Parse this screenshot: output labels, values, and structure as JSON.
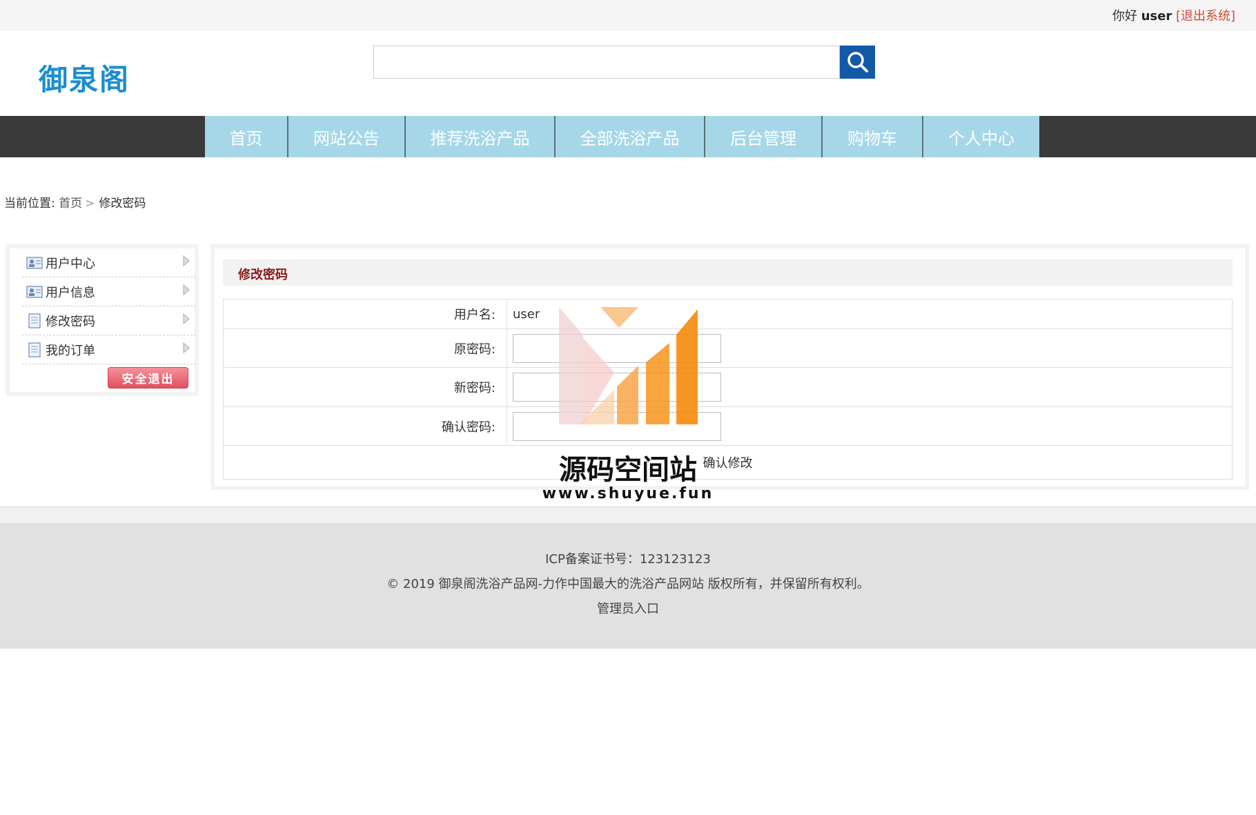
{
  "topbar": {
    "greeting": "你好",
    "username": "user",
    "logout": "[退出系统]"
  },
  "logo": {
    "text": "御泉阁"
  },
  "search": {
    "value": "",
    "placeholder": ""
  },
  "nav": {
    "items": [
      {
        "label": "首页"
      },
      {
        "label": "网站公告"
      },
      {
        "label": "推荐洗浴产品"
      },
      {
        "label": "全部洗浴产品"
      },
      {
        "label": "后台管理"
      },
      {
        "label": "购物车"
      },
      {
        "label": "个人中心"
      }
    ]
  },
  "breadcrumb": {
    "prefix": "当前位置:",
    "home": "首页",
    "separator": ">",
    "current": "修改密码"
  },
  "sidebar": {
    "items": [
      {
        "label": "用户中心",
        "icon": "user-card-icon"
      },
      {
        "label": "用户信息",
        "icon": "user-card-icon"
      },
      {
        "label": "修改密码",
        "icon": "document-icon"
      },
      {
        "label": "我的订单",
        "icon": "document-icon"
      }
    ],
    "exit_button": "安全退出"
  },
  "form": {
    "title": "修改密码",
    "username_label": "用户名:",
    "username_value": "user",
    "old_password_label": "原密码:",
    "new_password_label": "新密码:",
    "confirm_password_label": "确认密码:",
    "submit_label": "确认修改"
  },
  "footer": {
    "icp": "ICP备案证书号：123123123",
    "copyright": "© 2019 御泉阁洗浴产品网-力作中国最大的洗浴产品网站 版权所有，并保留所有权利。",
    "admin_link": "管理员入口"
  },
  "watermark": {
    "text": "源码空间站",
    "url": "www.shuyue.fun"
  },
  "colors": {
    "nav_bg": "#3a3a3a",
    "nav_item_bg": "#a6d7e8",
    "search_button": "#1259a8",
    "logo": "#1a8ed0",
    "panel_title": "#8b1a1a",
    "logout_link": "#d04a3a",
    "footer_bg": "#e1e1e1",
    "watermark_orange": "#f7941d"
  }
}
